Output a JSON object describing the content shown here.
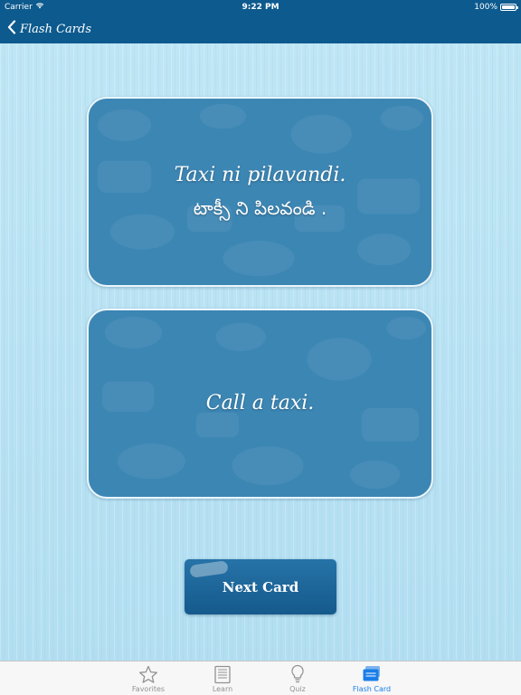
{
  "status_bar": {
    "carrier": "Carrier",
    "time": "9:22 PM",
    "battery": "100%"
  },
  "nav": {
    "back_label": "Flash Cards"
  },
  "cards": {
    "front": {
      "line1": "Taxi ni pilavandi.",
      "line2": "టాక్సీ ని పిలవండి ."
    },
    "back": {
      "text": "Call a taxi."
    }
  },
  "next_button": {
    "label": "Next Card"
  },
  "tabs": [
    {
      "label": "Favorites",
      "icon": "star-icon",
      "active": false
    },
    {
      "label": "Learn",
      "icon": "book-icon",
      "active": false
    },
    {
      "label": "Quiz",
      "icon": "lightbulb-icon",
      "active": false
    },
    {
      "label": "Flash Card",
      "icon": "flash-cards-icon",
      "active": true
    }
  ],
  "colors": {
    "nav_bg": "#0d5a8e",
    "card_bg": "#3c86b4",
    "page_bg": "#b8e3f3",
    "tab_active": "#1a7ee8",
    "tab_inactive": "#929292"
  }
}
